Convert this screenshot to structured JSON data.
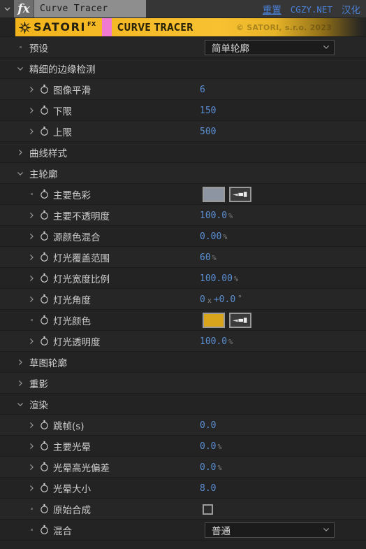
{
  "titlebar": {
    "caret_icon": "chevron-down-icon",
    "fx_label": "fx",
    "effect_name": "Curve Tracer",
    "reset_label": "重置",
    "site_label": "CGZY.NET",
    "localize_label": "汉化"
  },
  "banner": {
    "brand": "SATORI",
    "brand_fx": "FX",
    "product": "CURVE TRACER",
    "copyright": "© SATORI, s.r.o. 2023",
    "accent_color": "#f5bd24",
    "pink_color": "#f07ad0"
  },
  "colors": {
    "value_blue": "#5b8fd4",
    "link_blue": "#4a82d8",
    "main_swatch": "#8d95a3",
    "light_swatch": "#d9a51d"
  },
  "rows": [
    {
      "label": "预设",
      "marker": "dot",
      "indent": 0,
      "control": "dropdown",
      "value": "简单轮廓"
    },
    {
      "label": "精细的边缘检测",
      "marker": "twirl-open",
      "indent": 0,
      "control": "none",
      "value": ""
    },
    {
      "label": "图像平滑",
      "marker": "twirl-closed",
      "indent": 1,
      "stopwatch": true,
      "control": "value",
      "value": "6",
      "unit": ""
    },
    {
      "label": "下限",
      "marker": "twirl-closed",
      "indent": 1,
      "stopwatch": true,
      "control": "value",
      "value": "150",
      "unit": ""
    },
    {
      "label": "上限",
      "marker": "twirl-closed",
      "indent": 1,
      "stopwatch": true,
      "control": "value",
      "value": "500",
      "unit": ""
    },
    {
      "label": "曲线样式",
      "marker": "twirl-closed",
      "indent": 0,
      "control": "none",
      "value": ""
    },
    {
      "label": "主轮廓",
      "marker": "twirl-open",
      "indent": 0,
      "control": "none",
      "value": ""
    },
    {
      "label": "主要色彩",
      "marker": "dot",
      "indent": 1,
      "stopwatch": true,
      "control": "color",
      "swatch": "#8d95a3"
    },
    {
      "label": "主要不透明度",
      "marker": "twirl-closed",
      "indent": 1,
      "stopwatch": true,
      "control": "value",
      "value": "100.0",
      "unit": "%"
    },
    {
      "label": "源颜色混合",
      "marker": "twirl-closed",
      "indent": 1,
      "stopwatch": true,
      "control": "value",
      "value": "0.00",
      "unit": "%"
    },
    {
      "label": "灯光覆盖范围",
      "marker": "twirl-closed",
      "indent": 1,
      "stopwatch": true,
      "control": "value",
      "value": "60",
      "unit": "%"
    },
    {
      "label": "灯光宽度比例",
      "marker": "twirl-closed",
      "indent": 1,
      "stopwatch": true,
      "control": "value",
      "value": "100.00",
      "unit": "%"
    },
    {
      "label": "灯光角度",
      "marker": "twirl-closed",
      "indent": 1,
      "stopwatch": true,
      "control": "angle",
      "value": "0",
      "rotations_unit": "x",
      "angle": "+0.0",
      "degree": "°"
    },
    {
      "label": "灯光颜色",
      "marker": "dot",
      "indent": 1,
      "stopwatch": true,
      "control": "color",
      "swatch": "#d9a51d"
    },
    {
      "label": "灯光透明度",
      "marker": "twirl-closed",
      "indent": 1,
      "stopwatch": true,
      "control": "value",
      "value": "100.0",
      "unit": "%"
    },
    {
      "label": "草图轮廓",
      "marker": "twirl-closed",
      "indent": 0,
      "control": "none",
      "value": ""
    },
    {
      "label": "重影",
      "marker": "twirl-closed",
      "indent": 0,
      "control": "none",
      "value": ""
    },
    {
      "label": "渲染",
      "marker": "twirl-open",
      "indent": 0,
      "control": "none",
      "value": ""
    },
    {
      "label": "跳帧(s)",
      "marker": "twirl-closed",
      "indent": 1,
      "stopwatch": true,
      "control": "value",
      "value": "0.0",
      "unit": ""
    },
    {
      "label": "主要光晕",
      "marker": "twirl-closed",
      "indent": 1,
      "stopwatch": true,
      "control": "value",
      "value": "0.0",
      "unit": "%"
    },
    {
      "label": "光晕高光偏差",
      "marker": "twirl-closed",
      "indent": 1,
      "stopwatch": true,
      "control": "value",
      "value": "0.0",
      "unit": "%"
    },
    {
      "label": "光晕大小",
      "marker": "twirl-closed",
      "indent": 1,
      "stopwatch": true,
      "control": "value",
      "value": "8.0",
      "unit": ""
    },
    {
      "label": "原始合成",
      "marker": "dot",
      "indent": 1,
      "stopwatch": true,
      "control": "checkbox",
      "checked": false
    },
    {
      "label": "混合",
      "marker": "dot",
      "indent": 1,
      "stopwatch": true,
      "control": "dropdown",
      "value": "普通"
    }
  ]
}
